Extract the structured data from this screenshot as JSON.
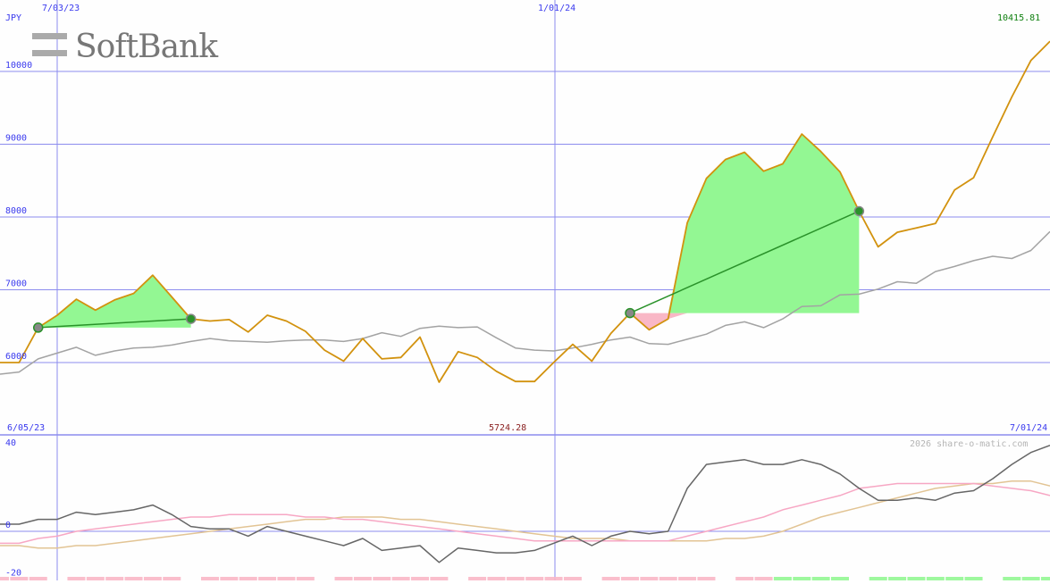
{
  "brand": {
    "logo_text": "SoftBank"
  },
  "colors": {
    "background": "#fefefe",
    "grid": "#8c8cee",
    "axis_text": "#3a3aee",
    "price": "#d2920e",
    "ma": "#a3a3a3",
    "gain_fill": "#93f793",
    "loss_fill": "#f9b7c6",
    "trade_line": "#2a922a",
    "last_price": "#108010",
    "hover": "#8b2222",
    "osc_main": "#666666",
    "osc_signal1": "#f7a7c4",
    "osc_signal2": "#e2c494",
    "copyright": "#b5b5b5"
  },
  "chart_data": [
    {
      "type": "line",
      "unit_label": "JPY",
      "date_labels": [
        "7/03/23",
        "1/01/24"
      ],
      "y_ticks": [
        6000,
        7000,
        8000,
        9000,
        10000
      ],
      "ylim": [
        5000,
        10900
      ],
      "last_value_label": "10415.81",
      "hover_value_label": "5724.28",
      "grid": true,
      "series": [
        {
          "role": "price",
          "values": [
            6000,
            6000,
            6480,
            6650,
            6870,
            6720,
            6860,
            6950,
            7200,
            6900,
            6600,
            6570,
            6590,
            6420,
            6650,
            6570,
            6430,
            6170,
            6020,
            6330,
            6050,
            6070,
            6350,
            5730,
            6150,
            6070,
            5880,
            5740,
            5740,
            6000,
            6250,
            6020,
            6400,
            6680,
            6450,
            6600,
            7920,
            8530,
            8790,
            8890,
            8630,
            8730,
            9140,
            8900,
            8620,
            8080,
            7590,
            7790,
            7850,
            7910,
            8370,
            8540,
            9100,
            9650,
            10150,
            10415
          ]
        },
        {
          "role": "moving-average",
          "values": [
            5840,
            5870,
            6050,
            6130,
            6210,
            6100,
            6160,
            6200,
            6210,
            6240,
            6290,
            6330,
            6300,
            6290,
            6280,
            6300,
            6310,
            6310,
            6290,
            6330,
            6410,
            6360,
            6470,
            6500,
            6480,
            6490,
            6340,
            6200,
            6170,
            6160,
            6200,
            6250,
            6310,
            6350,
            6260,
            6250,
            6320,
            6390,
            6510,
            6560,
            6480,
            6600,
            6770,
            6780,
            6930,
            6940,
            7010,
            7110,
            7090,
            7250,
            7320,
            7400,
            7460,
            7430,
            7540,
            7800
          ]
        }
      ],
      "trades": [
        {
          "entry": {
            "index": 2,
            "value": 6480
          },
          "exit": {
            "index": 10,
            "value": 6600
          }
        },
        {
          "entry": {
            "index": 33,
            "value": 6680
          },
          "exit": {
            "index": 45,
            "value": 8080
          }
        }
      ]
    },
    {
      "type": "line",
      "date_labels": [
        "6/05/23",
        "7/01/24"
      ],
      "y_ticks": [
        -20,
        0,
        40
      ],
      "ylim": [
        -24,
        44
      ],
      "copyright": "2026 share-o-matic.com",
      "grid": true,
      "series": [
        {
          "role": "oscillator",
          "values": [
            3,
            3,
            5,
            5,
            8,
            7,
            8,
            9,
            11,
            7,
            2,
            1,
            1,
            -2,
            2,
            0,
            -2,
            -4,
            -6,
            -3,
            -8,
            -7,
            -6,
            -13,
            -7,
            -8,
            -9,
            -9,
            -8,
            -5,
            -2,
            -6,
            -2,
            0,
            -1,
            0,
            18,
            28,
            29,
            30,
            28,
            28,
            30,
            28,
            24,
            18,
            13,
            13,
            14,
            13,
            16,
            17,
            22,
            28,
            33,
            36
          ]
        },
        {
          "role": "signal-fast",
          "values": [
            -5,
            -5,
            -3,
            -2,
            0,
            1,
            2,
            3,
            4,
            5,
            6,
            6,
            7,
            7,
            7,
            7,
            6,
            6,
            5,
            5,
            4,
            3,
            2,
            1,
            0,
            -1,
            -2,
            -3,
            -4,
            -4,
            -4,
            -4,
            -4,
            -4,
            -4,
            -4,
            -2,
            0,
            2,
            4,
            6,
            9,
            11,
            13,
            15,
            18,
            19,
            20,
            20,
            20,
            20,
            20,
            19,
            18,
            17,
            15
          ]
        },
        {
          "role": "signal-slow",
          "values": [
            -6,
            -6,
            -7,
            -7,
            -6,
            -6,
            -5,
            -4,
            -3,
            -2,
            -1,
            0,
            1,
            2,
            3,
            4,
            5,
            5,
            6,
            6,
            6,
            5,
            5,
            4,
            3,
            2,
            1,
            0,
            -1,
            -2,
            -3,
            -3,
            -3,
            -4,
            -4,
            -4,
            -4,
            -4,
            -3,
            -3,
            -2,
            0,
            3,
            6,
            8,
            10,
            12,
            14,
            16,
            18,
            19,
            20,
            20,
            21,
            21,
            19
          ]
        }
      ],
      "histogram": [
        -9,
        -9,
        -9,
        -10,
        -10,
        -10,
        -10,
        -10,
        -10,
        -10,
        -10,
        -10,
        -10,
        -10,
        -10,
        -10,
        -10,
        -10,
        -10,
        -10,
        -10,
        -10,
        -10,
        -10,
        -10,
        -10,
        -10,
        -10,
        -10,
        -10,
        -10,
        -10,
        -10,
        -10,
        -10,
        -10,
        -10,
        -10,
        -10,
        -10,
        -10,
        -10,
        -10,
        -10,
        -10,
        -10,
        -10,
        -10,
        -10,
        -10,
        -10,
        -10,
        -10,
        -10,
        -10,
        -10
      ]
    }
  ]
}
